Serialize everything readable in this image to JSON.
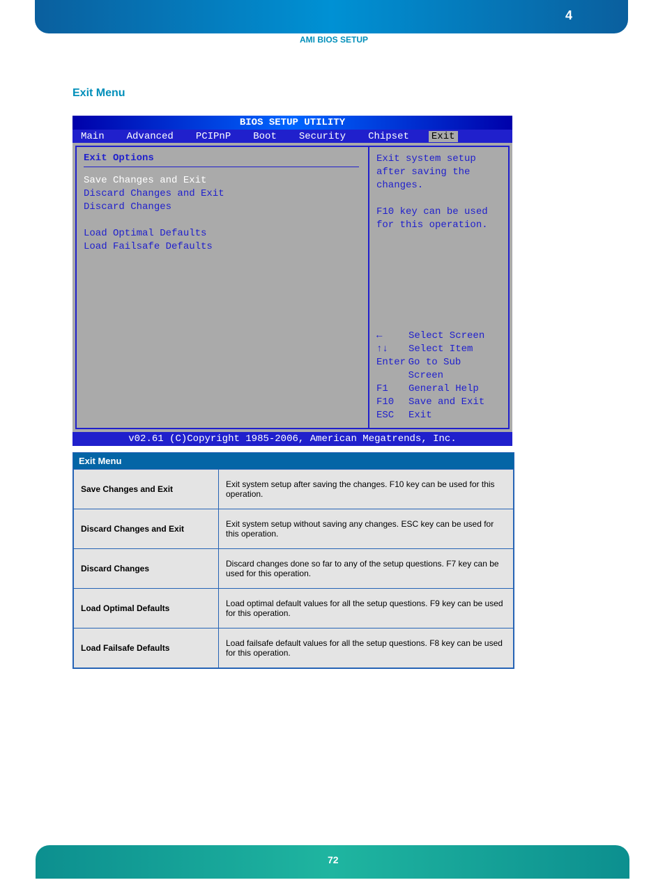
{
  "header": {
    "chapter_num": "4",
    "chapter_label": "AMI BIOS SETUP"
  },
  "section_title": "Exit Menu",
  "bios": {
    "title": "BIOS SETUP UTILITY",
    "menu": [
      "Main",
      "Advanced",
      "PCIPnP",
      "Boot",
      "Security",
      "Chipset",
      "Exit"
    ],
    "menu_active": "Exit",
    "left_heading": "Exit Options",
    "options": {
      "o1": "Save Changes and Exit",
      "o2": "Discard Changes and Exit",
      "o3": "Discard Changes",
      "o4": "Load Optimal Defaults",
      "o5": "Load Failsafe Defaults"
    },
    "help1": "Exit system setup after saving the changes.",
    "help2": "F10 key can be used for this operation.",
    "keys": {
      "k1": {
        "key": "←",
        "desc": "Select Screen"
      },
      "k2": {
        "key": "↑↓",
        "desc": "Select Item"
      },
      "k3": {
        "key": "Enter",
        "desc": "Go to Sub Screen"
      },
      "k4": {
        "key": "F1",
        "desc": "General Help"
      },
      "k5": {
        "key": "F10",
        "desc": "Save and Exit"
      },
      "k6": {
        "key": "ESC",
        "desc": "Exit"
      }
    },
    "footer": "v02.61 (C)Copyright 1985-2006, American Megatrends, Inc."
  },
  "table": {
    "header": "Exit Menu",
    "rows": [
      {
        "name": "Save Changes and Exit",
        "desc": "Exit system setup after saving the changes. F10 key can be used for this operation."
      },
      {
        "name": "Discard Changes and Exit",
        "desc": "Exit system setup without saving any changes. ESC key can be used for this operation."
      },
      {
        "name": "Discard Changes",
        "desc": "Discard changes done so far to any of the setup questions. F7 key can be used for this operation."
      },
      {
        "name": "Load Optimal Defaults",
        "desc": "Load optimal default values for all the setup questions. F9 key can be used for this operation."
      },
      {
        "name": "Load Failsafe Defaults",
        "desc": "Load failsafe default values for all the setup questions. F8 key can be used for this operation."
      }
    ]
  },
  "page_num": "72"
}
